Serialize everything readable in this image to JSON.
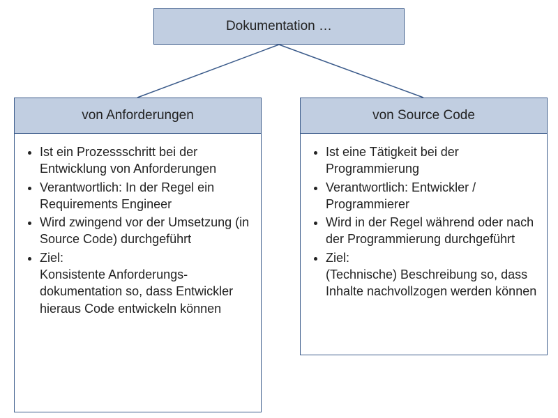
{
  "root": {
    "title": "Dokumentation …"
  },
  "left": {
    "title": "von Anforderungen",
    "items": [
      "Ist ein Prozessschritt bei der Entwicklung von Anforderungen",
      "Verantwortlich: In der Regel ein Requirements Engineer",
      "Wird zwingend vor der Umsetzung (in Source Code) durchgeführt",
      "Ziel:\nKonsistente Anforderungs-dokumentation so, dass Entwickler hieraus Code entwickeln können"
    ]
  },
  "right": {
    "title": "von Source Code",
    "items": [
      "Ist eine Tätigkeit bei der Programmierung",
      "Verantwortlich: Entwickler / Programmierer",
      "Wird in der Regel während oder nach der Programmierung durchgeführt",
      "Ziel:\n(Technische) Beschreibung so, dass Inhalte nachvollzogen werden können"
    ]
  },
  "colors": {
    "header_bg": "#c1cee1",
    "border": "#3a5a8a"
  }
}
